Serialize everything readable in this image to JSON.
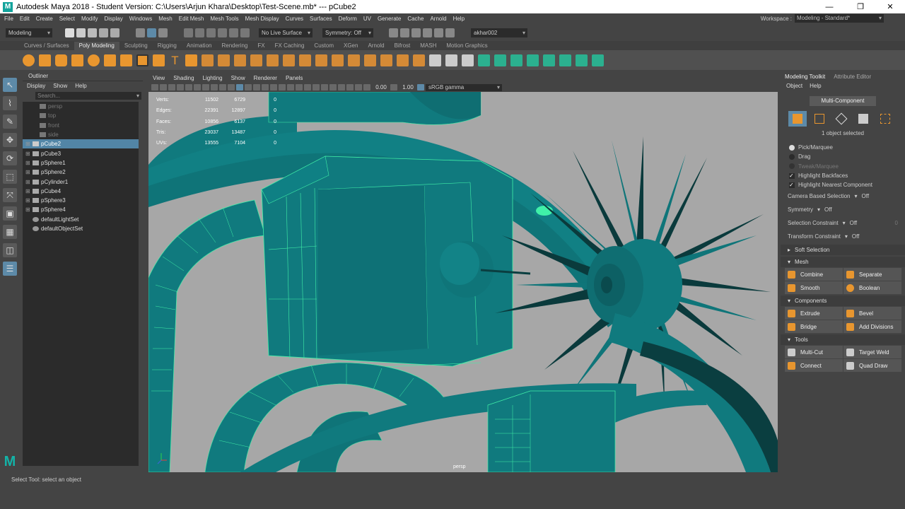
{
  "titlebar": {
    "title": "Autodesk Maya 2018 - Student Version: C:\\Users\\Arjun Khara\\Desktop\\Test-Scene.mb*  ---  pCube2",
    "minimize": "—",
    "maximize": "❐",
    "close": "✕"
  },
  "menubar": {
    "items": [
      "File",
      "Edit",
      "Create",
      "Select",
      "Modify",
      "Display",
      "Windows",
      "Mesh",
      "Edit Mesh",
      "Mesh Tools",
      "Mesh Display",
      "Curves",
      "Surfaces",
      "Deform",
      "UV",
      "Generate",
      "Cache",
      "Arnold",
      "Help"
    ],
    "workspace_label": "Workspace :",
    "workspace_value": "Modeling - Standard*"
  },
  "statusline": {
    "menuset": "Modeling",
    "live_surface": "No Live Surface",
    "symmetry": "Symmetry: Off",
    "user": "akhar002"
  },
  "shelf": {
    "tabs": [
      "Curves / Surfaces",
      "Poly Modeling",
      "Sculpting",
      "Rigging",
      "Animation",
      "Rendering",
      "FX",
      "FX Caching",
      "Custom",
      "XGen",
      "Arnold",
      "Bifrost",
      "MASH",
      "Motion Graphics"
    ],
    "active_tab": "Poly Modeling"
  },
  "outliner": {
    "title": "Outliner",
    "menus": [
      "Display",
      "Show",
      "Help"
    ],
    "search_placeholder": "Search...",
    "items": [
      {
        "label": "persp",
        "dim": true
      },
      {
        "label": "top",
        "dim": true
      },
      {
        "label": "front",
        "dim": true
      },
      {
        "label": "side",
        "dim": true
      },
      {
        "label": "pCube2",
        "selected": true
      },
      {
        "label": "pCube3"
      },
      {
        "label": "pSphere1"
      },
      {
        "label": "pSphere2"
      },
      {
        "label": "pCylinder1"
      },
      {
        "label": "pCube4"
      },
      {
        "label": "pSphere3"
      },
      {
        "label": "pSphere4"
      },
      {
        "label": "defaultLightSet"
      },
      {
        "label": "defaultObjectSet"
      }
    ]
  },
  "viewport": {
    "menus": [
      "View",
      "Shading",
      "Lighting",
      "Show",
      "Renderer",
      "Panels"
    ],
    "exposure": "0.00",
    "gamma": "1.00",
    "color_space": "sRGB gamma",
    "camera": "persp",
    "hud": [
      {
        "label": "Verts:",
        "a": "11502",
        "b": "6729",
        "c": "0"
      },
      {
        "label": "Edges:",
        "a": "22391",
        "b": "12897",
        "c": "0"
      },
      {
        "label": "Faces:",
        "a": "10856",
        "b": "6137",
        "c": "0"
      },
      {
        "label": "Tris:",
        "a": "23037",
        "b": "13487",
        "c": "0"
      },
      {
        "label": "UVs:",
        "a": "13555",
        "b": "7104",
        "c": "0"
      }
    ]
  },
  "sidepanel": {
    "tabs": [
      "Modeling Toolkit",
      "Attribute Editor"
    ],
    "menus": [
      "Object",
      "Help"
    ],
    "mode_button": "Multi-Component",
    "object_count": "1 object selected",
    "pick_marquee": "Pick/Marquee",
    "drag": "Drag",
    "tweak_marquee": "Tweak/Marquee",
    "highlight_backfaces": "Highlight Backfaces",
    "highlight_nearest": "Highlight Nearest Component",
    "camera_based": "Camera Based Selection",
    "camera_based_value": "Off",
    "symmetry": "Symmetry",
    "symmetry_value": "Off",
    "selection_constraint": "Selection Constraint",
    "selection_constraint_value": "Off",
    "selection_constraint_num": "0",
    "transform_constraint": "Transform Constraint",
    "transform_constraint_value": "Off",
    "soft_selection": "Soft Selection",
    "mesh_title": "Mesh",
    "combine": "Combine",
    "separate": "Separate",
    "smooth": "Smooth",
    "boolean": "Boolean",
    "components_title": "Components",
    "extrude": "Extrude",
    "bevel": "Bevel",
    "bridge": "Bridge",
    "add_divisions": "Add Divisions",
    "tools_title": "Tools",
    "multi_cut": "Multi-Cut",
    "target_weld": "Target Weld",
    "connect": "Connect",
    "quad_draw": "Quad Draw"
  },
  "helpline": "Select Tool: select an object",
  "colors": {
    "mesh": "#107a7e",
    "wire": "#40f0a8",
    "selection": "#5285a6"
  }
}
